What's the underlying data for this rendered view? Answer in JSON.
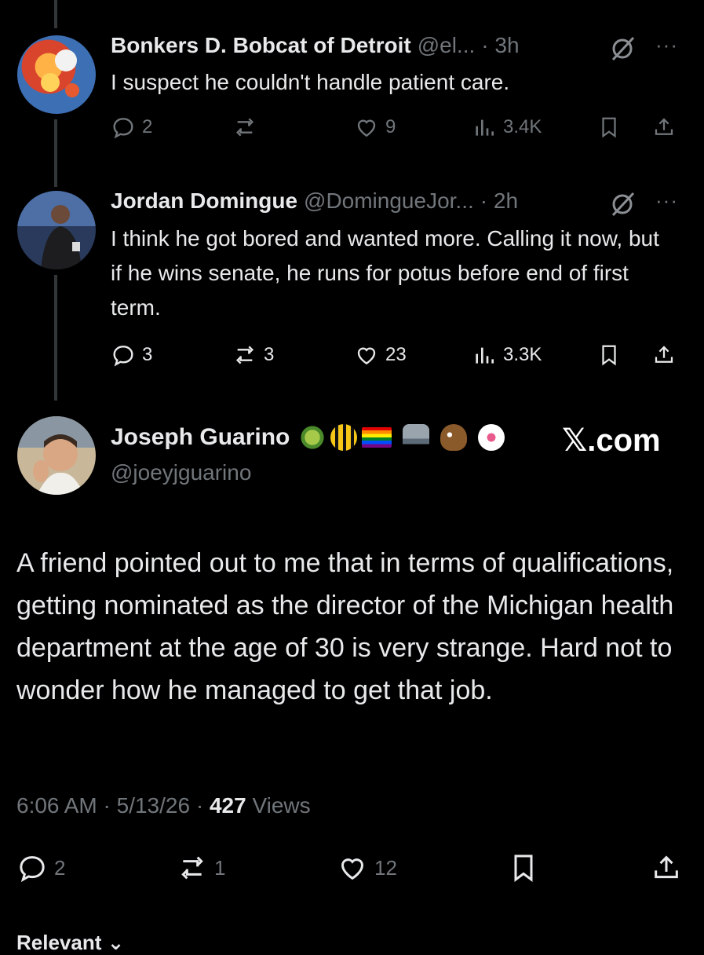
{
  "tweets": [
    {
      "name": "Bonkers D. Bobcat of Detroit",
      "handle": "@el...",
      "time": "· 3h",
      "text": "I suspect he couldn't handle patient care.",
      "replies": "2",
      "reposts": "",
      "likes": "9",
      "views": "3.4K"
    },
    {
      "name": "Jordan Domingue",
      "handle": "@DomingueJor...",
      "time": "· 2h",
      "text": "I think he got bored and wanted more. Calling it now, but if he wins senate, he runs for potus before end of first term.",
      "replies": "3",
      "reposts": "3",
      "likes": "23",
      "views": "3.3K"
    }
  ],
  "main": {
    "name": "Joseph Guarino",
    "handle": "@joeyjguarino",
    "brand": "𝕏.com",
    "text": "A friend pointed out to me that in terms of qualifications, getting nominated as the director of the Michigan health department at the age of 30 is very strange. Hard not to wonder how he managed to get that job.",
    "time": "6:06 AM",
    "date": "5/13/26",
    "views_count": "427",
    "views_label": "Views",
    "replies": "2",
    "reposts": "1",
    "likes": "12"
  },
  "relevant_label": "Relevant ⌄",
  "colors": {
    "background": "#000000",
    "text": "#e7e9ea",
    "muted": "#71767b"
  }
}
